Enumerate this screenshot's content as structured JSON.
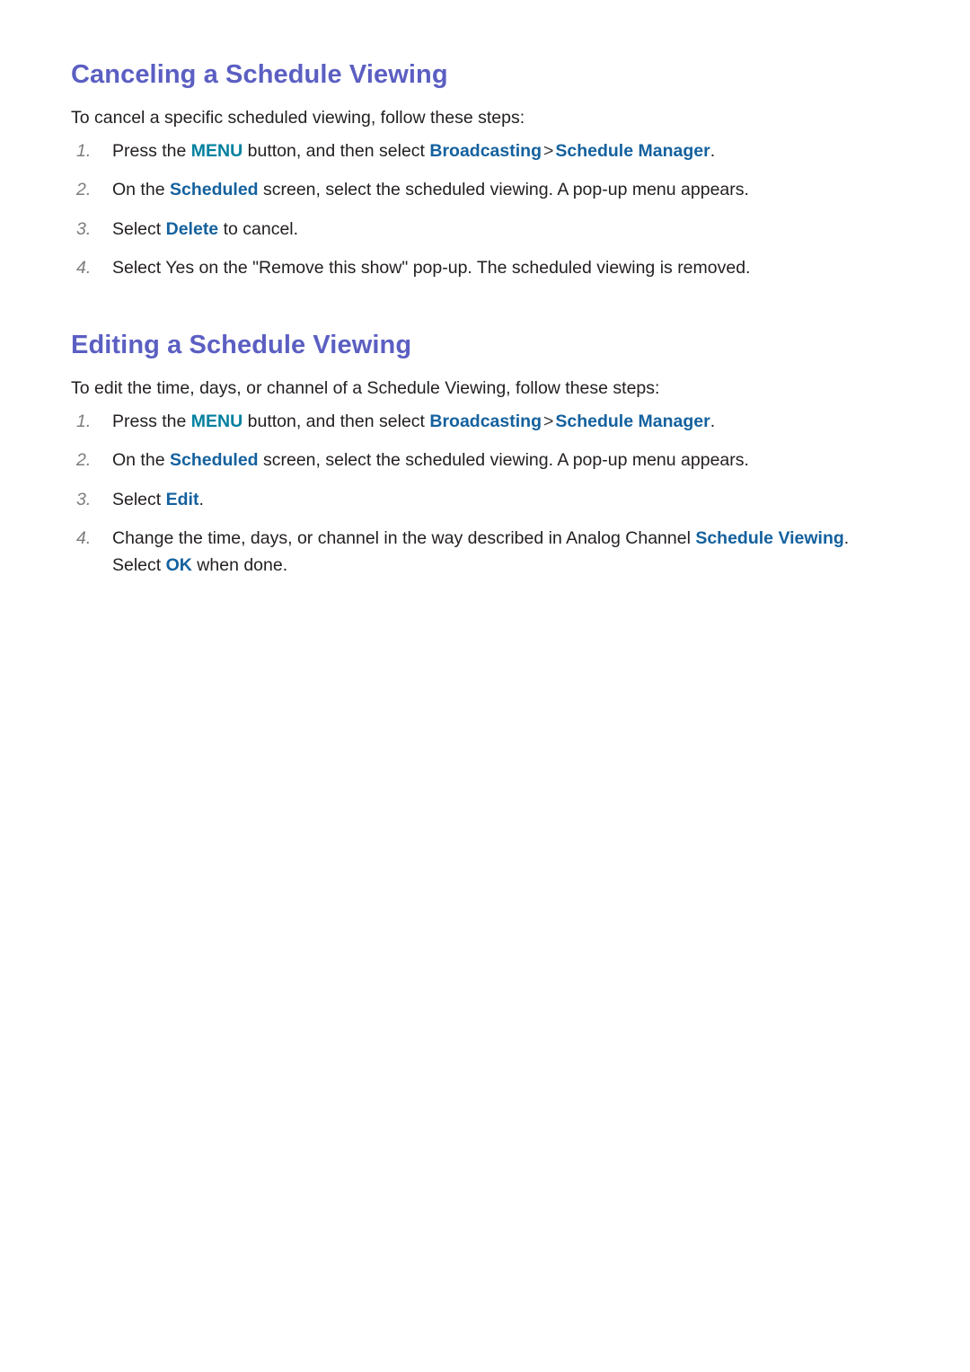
{
  "document": {
    "background_color": "#ffffff",
    "heading_color": "#5b5fc2",
    "body_color": "#231f20",
    "accent_teal": "#00809f",
    "accent_blue": "#14619e",
    "numeral_color": "#7d7d7d"
  },
  "sections": [
    {
      "heading": "Canceling a Schedule Viewing",
      "intro": "To cancel a specific scheduled viewing, follow these steps:",
      "steps": [
        {
          "number": "1.",
          "parts": [
            {
              "text": "Press the ",
              "style": "plain"
            },
            {
              "text": "MENU",
              "style": "teal"
            },
            {
              "text": " button, and then select ",
              "style": "plain"
            },
            {
              "text": "Broadcasting",
              "style": "blue"
            },
            {
              "text": ">",
              "style": "sep"
            },
            {
              "text": "Schedule Manager",
              "style": "blue"
            },
            {
              "text": ".",
              "style": "plain"
            }
          ]
        },
        {
          "number": "2.",
          "parts": [
            {
              "text": "On the ",
              "style": "plain"
            },
            {
              "text": "Scheduled",
              "style": "blue"
            },
            {
              "text": " screen, select the scheduled viewing. A pop-up menu appears.",
              "style": "plain"
            }
          ]
        },
        {
          "number": "3.",
          "parts": [
            {
              "text": "Select ",
              "style": "plain"
            },
            {
              "text": "Delete",
              "style": "blue"
            },
            {
              "text": " to cancel.",
              "style": "plain"
            }
          ]
        },
        {
          "number": "4.",
          "parts": [
            {
              "text": "Select Yes on the \"Remove this show\" pop-up. The scheduled viewing is removed.",
              "style": "plain"
            }
          ]
        }
      ]
    },
    {
      "heading": "Editing a Schedule Viewing",
      "intro": "To edit the time, days, or channel of a Schedule Viewing, follow these steps:",
      "steps": [
        {
          "number": "1.",
          "parts": [
            {
              "text": "Press the ",
              "style": "plain"
            },
            {
              "text": "MENU",
              "style": "teal"
            },
            {
              "text": " button, and then select ",
              "style": "plain"
            },
            {
              "text": "Broadcasting",
              "style": "blue"
            },
            {
              "text": ">",
              "style": "sep"
            },
            {
              "text": "Schedule Manager",
              "style": "blue"
            },
            {
              "text": ".",
              "style": "plain"
            }
          ]
        },
        {
          "number": "2.",
          "parts": [
            {
              "text": "On the ",
              "style": "plain"
            },
            {
              "text": "Scheduled",
              "style": "blue"
            },
            {
              "text": " screen, select the scheduled viewing. A pop-up menu appears.",
              "style": "plain"
            }
          ]
        },
        {
          "number": "3.",
          "parts": [
            {
              "text": "Select ",
              "style": "plain"
            },
            {
              "text": "Edit",
              "style": "blue"
            },
            {
              "text": ".",
              "style": "plain"
            }
          ]
        },
        {
          "number": "4.",
          "parts": [
            {
              "text": "Change the time, days, or channel in the way described in Analog Channel ",
              "style": "plain"
            },
            {
              "text": "Schedule Viewing",
              "style": "blue"
            },
            {
              "text": ". Select ",
              "style": "plain"
            },
            {
              "text": "OK",
              "style": "blue"
            },
            {
              "text": " when done.",
              "style": "plain"
            }
          ]
        }
      ]
    }
  ]
}
